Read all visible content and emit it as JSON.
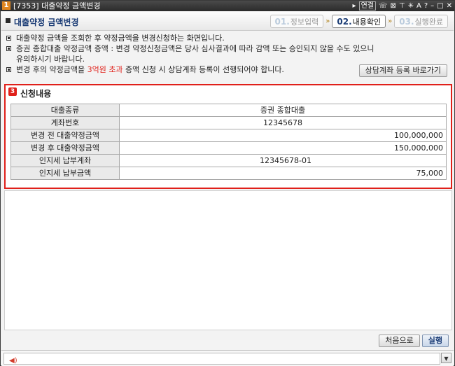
{
  "window": {
    "number": "1",
    "title": "[7353] 대출약정 금액변경",
    "link_label": "연결",
    "icons": [
      "arrow-right-icon",
      "phone-icon",
      "close-box-icon",
      "pin-icon",
      "settings-icon",
      "font-icon",
      "help-icon",
      "minimize-icon",
      "maximize-icon",
      "close-icon"
    ]
  },
  "header": {
    "title": "대출약정 금액변경",
    "steps": [
      {
        "num": "01.",
        "label": "정보입력",
        "active": false
      },
      {
        "num": "02.",
        "label": "내용확인",
        "active": true
      },
      {
        "num": "03.",
        "label": "실행완료",
        "active": false
      }
    ]
  },
  "notes": [
    {
      "text": "대출약정 금액을 조회한 후 약정금액을 변경신청하는 화면입니다."
    },
    {
      "text": "증권 종합대출 약정금액 증액 : 변경 약정신청금액은 당사 심사결과에 따라 감액 또는 승인되지 않을 수도 있으니"
    },
    {
      "text": "유의하시기 바랍니다.",
      "indent": true
    },
    {
      "pre": "변경 후의 약정금액을 ",
      "highlight": "3억원 초과",
      "post": " 증액 신청 시 상담계좌 등록이 선행되어야 합니다."
    }
  ],
  "consult_button": "상담계좌 등록 바로가기",
  "section": {
    "badge": "3",
    "title": "신청내용",
    "rows": [
      {
        "label": "대출종류",
        "value": "증권 종합대출",
        "align": "center"
      },
      {
        "label": "계좌번호",
        "value": "12345678",
        "align": "center"
      },
      {
        "label": "변경 전 대출약정금액",
        "value": "100,000,000",
        "align": "right"
      },
      {
        "label": "변경 후 대출약정금액",
        "value": "150,000,000",
        "align": "right"
      },
      {
        "label": "인지세 납부계좌",
        "value": "12345678-01",
        "align": "left"
      },
      {
        "label": "인지세 납부금액",
        "value": "75,000",
        "align": "right"
      }
    ]
  },
  "buttons": {
    "first": "처음으로",
    "run": "실행"
  },
  "status": {
    "text": ""
  },
  "colors": {
    "accent": "#e0201a",
    "header_text": "#1b3c75",
    "title_bar": "#2b2b2b"
  }
}
